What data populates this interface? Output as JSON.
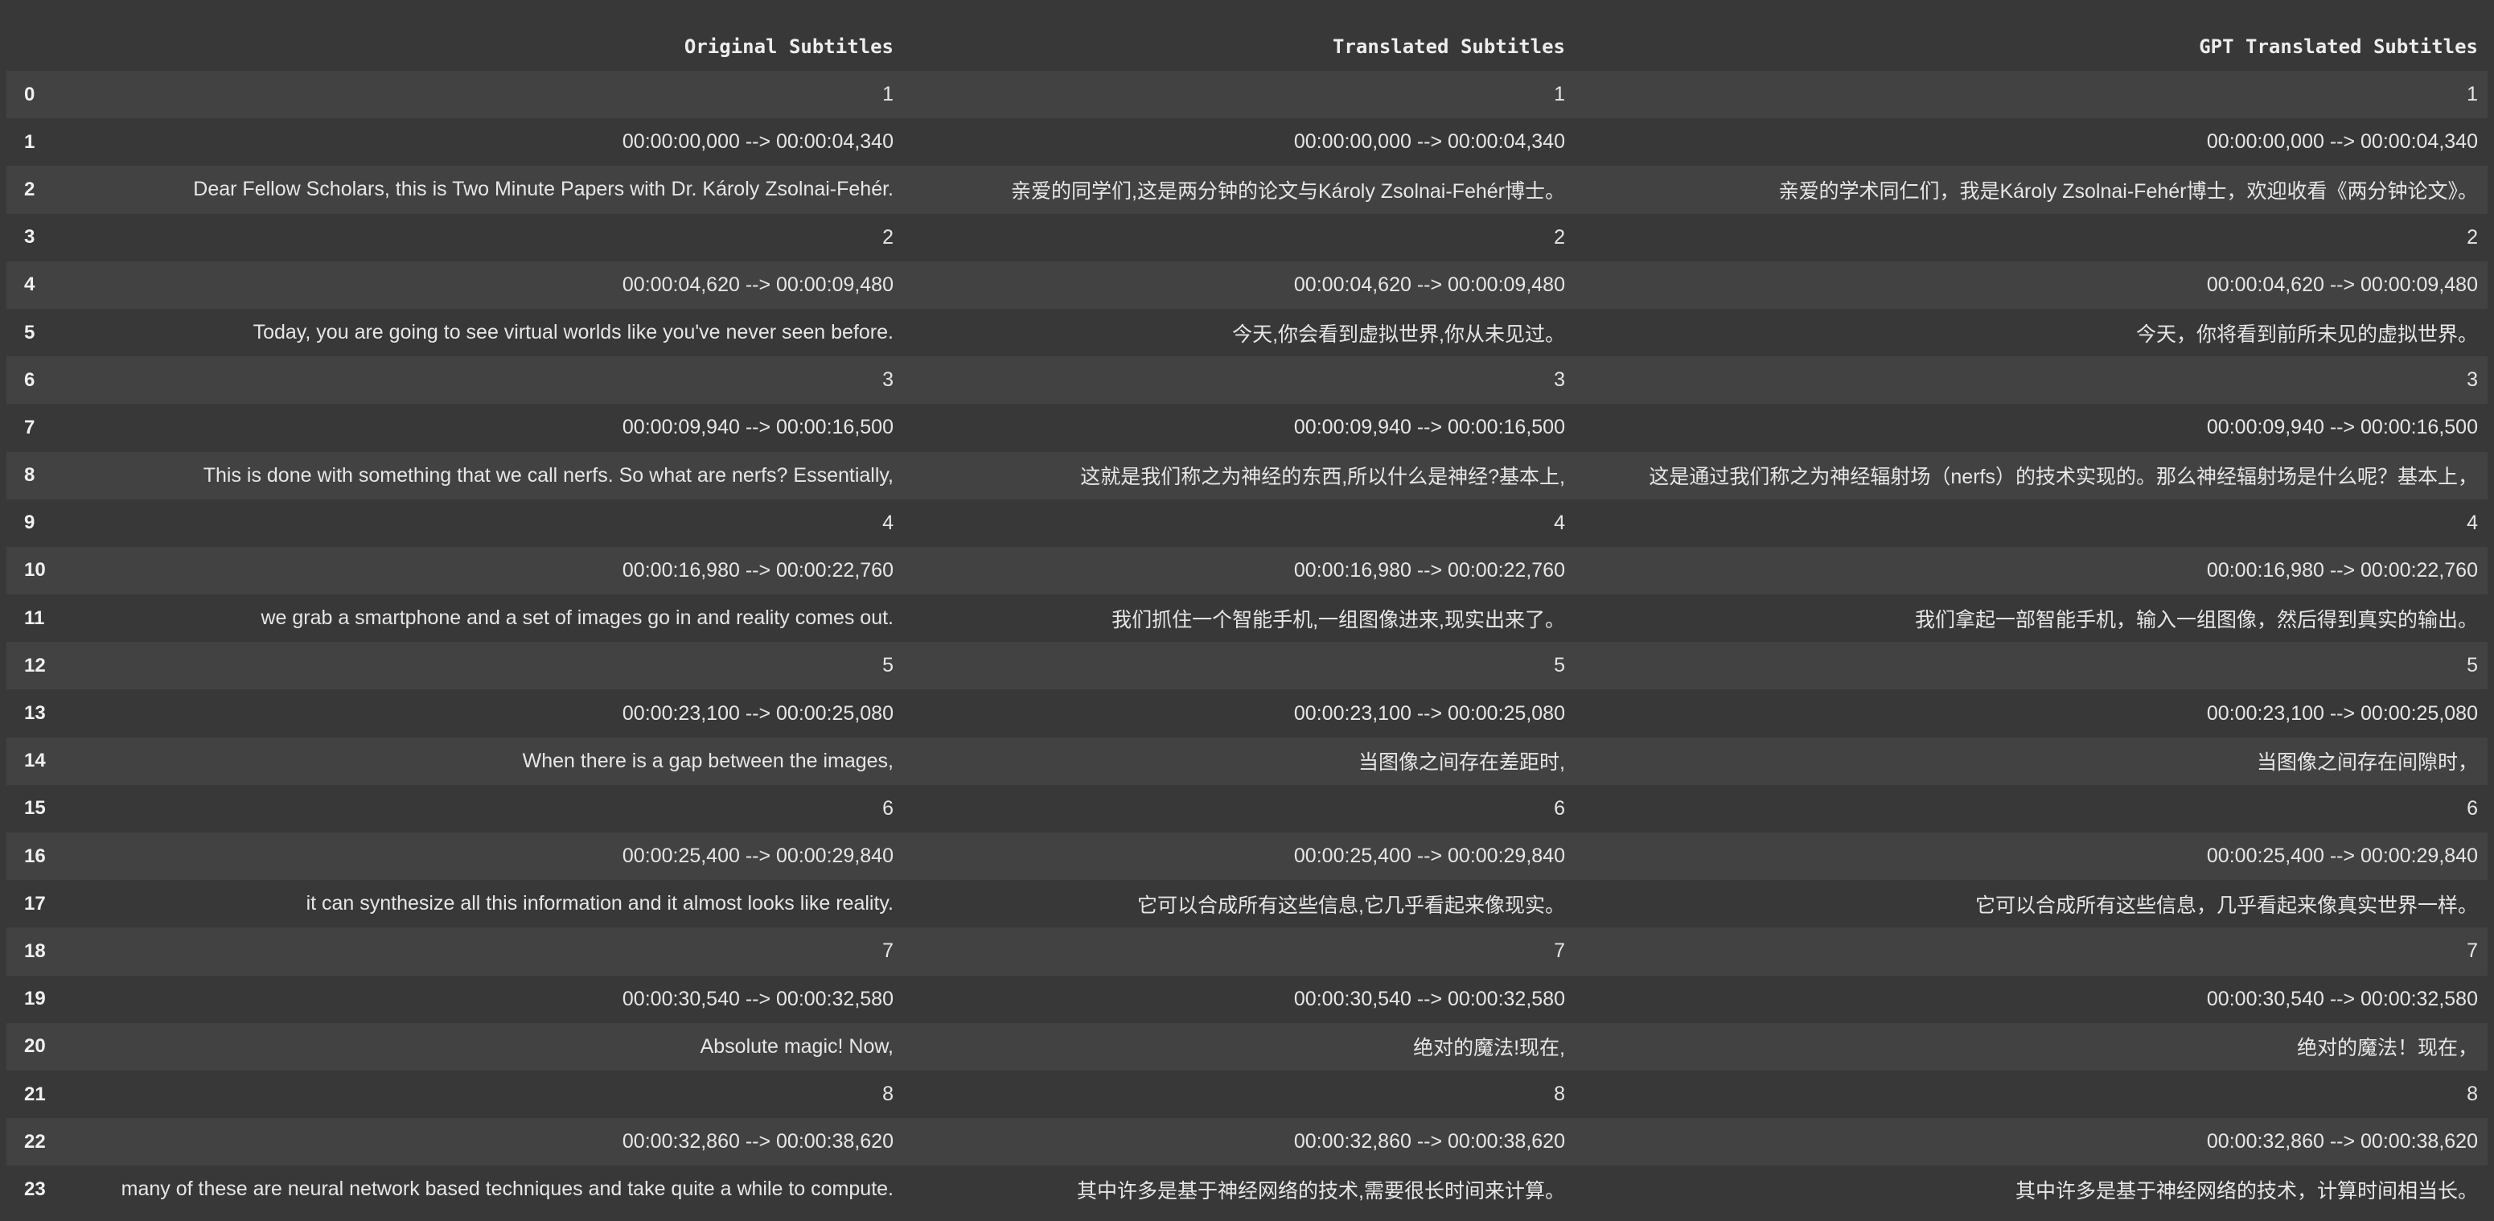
{
  "table": {
    "columns": [
      "",
      "Original Subtitles",
      "Translated Subtitles",
      "GPT Translated Subtitles"
    ],
    "rows": [
      {
        "index": "0",
        "original": "1",
        "translated": "1",
        "gpt": "1"
      },
      {
        "index": "1",
        "original": "00:00:00,000 --> 00:00:04,340",
        "translated": "00:00:00,000 --> 00:00:04,340",
        "gpt": "00:00:00,000 --> 00:00:04,340"
      },
      {
        "index": "2",
        "original": "Dear Fellow Scholars, this is Two Minute Papers with Dr. Károly Zsolnai-Fehér.",
        "translated": "亲爱的同学们,这是两分钟的论文与Károly Zsolnai-Fehér博士。",
        "gpt": "亲爱的学术同仁们，我是Károly Zsolnai-Fehér博士，欢迎收看《两分钟论文》。"
      },
      {
        "index": "3",
        "original": "2",
        "translated": "2",
        "gpt": "2"
      },
      {
        "index": "4",
        "original": "00:00:04,620 --> 00:00:09,480",
        "translated": "00:00:04,620 --> 00:00:09,480",
        "gpt": "00:00:04,620 --> 00:00:09,480"
      },
      {
        "index": "5",
        "original": "Today, you are going to see virtual worlds like you've never seen before.",
        "translated": "今天,你会看到虚拟世界,你从未见过。",
        "gpt": "今天，你将看到前所未见的虚拟世界。"
      },
      {
        "index": "6",
        "original": "3",
        "translated": "3",
        "gpt": "3"
      },
      {
        "index": "7",
        "original": "00:00:09,940 --> 00:00:16,500",
        "translated": "00:00:09,940 --> 00:00:16,500",
        "gpt": "00:00:09,940 --> 00:00:16,500"
      },
      {
        "index": "8",
        "original": "This is done with something that we call nerfs. So what are nerfs? Essentially,",
        "translated": "这就是我们称之为神经的东西,所以什么是神经?基本上,",
        "gpt": "这是通过我们称之为神经辐射场（nerfs）的技术实现的。那么神经辐射场是什么呢？基本上，"
      },
      {
        "index": "9",
        "original": "4",
        "translated": "4",
        "gpt": "4"
      },
      {
        "index": "10",
        "original": "00:00:16,980 --> 00:00:22,760",
        "translated": "00:00:16,980 --> 00:00:22,760",
        "gpt": "00:00:16,980 --> 00:00:22,760"
      },
      {
        "index": "11",
        "original": "we grab a smartphone and a set of images go in and reality comes out.",
        "translated": "我们抓住一个智能手机,一组图像进来,现实出来了。",
        "gpt": "我们拿起一部智能手机，输入一组图像，然后得到真实的输出。"
      },
      {
        "index": "12",
        "original": "5",
        "translated": "5",
        "gpt": "5"
      },
      {
        "index": "13",
        "original": "00:00:23,100 --> 00:00:25,080",
        "translated": "00:00:23,100 --> 00:00:25,080",
        "gpt": "00:00:23,100 --> 00:00:25,080"
      },
      {
        "index": "14",
        "original": "When there is a gap between the images,",
        "translated": "当图像之间存在差距时,",
        "gpt": "当图像之间存在间隙时，"
      },
      {
        "index": "15",
        "original": "6",
        "translated": "6",
        "gpt": "6"
      },
      {
        "index": "16",
        "original": "00:00:25,400 --> 00:00:29,840",
        "translated": "00:00:25,400 --> 00:00:29,840",
        "gpt": "00:00:25,400 --> 00:00:29,840"
      },
      {
        "index": "17",
        "original": "it can synthesize all this information and it almost looks like reality.",
        "translated": "它可以合成所有这些信息,它几乎看起来像现实。",
        "gpt": "它可以合成所有这些信息，几乎看起来像真实世界一样。"
      },
      {
        "index": "18",
        "original": "7",
        "translated": "7",
        "gpt": "7"
      },
      {
        "index": "19",
        "original": "00:00:30,540 --> 00:00:32,580",
        "translated": "00:00:30,540 --> 00:00:32,580",
        "gpt": "00:00:30,540 --> 00:00:32,580"
      },
      {
        "index": "20",
        "original": "Absolute magic! Now,",
        "translated": "绝对的魔法!现在,",
        "gpt": "绝对的魔法！现在，"
      },
      {
        "index": "21",
        "original": "8",
        "translated": "8",
        "gpt": "8"
      },
      {
        "index": "22",
        "original": "00:00:32,860 --> 00:00:38,620",
        "translated": "00:00:32,860 --> 00:00:38,620",
        "gpt": "00:00:32,860 --> 00:00:38,620"
      },
      {
        "index": "23",
        "original": "many of these are neural network based techniques and take quite a while to compute.",
        "translated": "其中许多是基于神经网络的技术,需要很长时间来计算。",
        "gpt": "其中许多是基于神经网络的技术，计算时间相当长。"
      }
    ]
  }
}
